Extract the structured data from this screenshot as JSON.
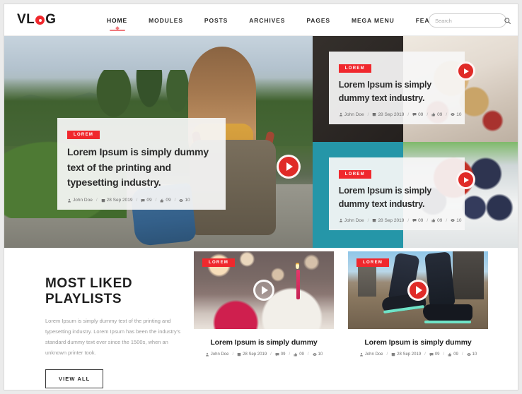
{
  "header": {
    "logo": {
      "pre": "VL",
      "post": "G",
      "icon": "record-dot-icon"
    },
    "nav": [
      {
        "label": "HOME",
        "active": true
      },
      {
        "label": "MODULES",
        "active": false
      },
      {
        "label": "POSTS",
        "active": false
      },
      {
        "label": "ARCHIVES",
        "active": false
      },
      {
        "label": "PAGES",
        "active": false
      },
      {
        "label": "MEGA MENU",
        "active": false
      },
      {
        "label": "FEATURES",
        "active": false
      }
    ],
    "search": {
      "placeholder": "Search",
      "value": "",
      "icon": "search-icon"
    }
  },
  "hero": {
    "main": {
      "badge": "LOREM",
      "title": "Lorem Ipsum is simply dummy text of the printing and typesetting industry.",
      "meta": {
        "author": "John Doe",
        "date": "28 Sep 2019",
        "comments": "09",
        "likes": "09",
        "views": "10"
      },
      "play": "play-button-icon"
    },
    "right_top": {
      "badge": "LOREM",
      "title": "Lorem Ipsum is simply dummy text industry.",
      "meta": {
        "author": "John Doe",
        "date": "28 Sep 2019",
        "comments": "09",
        "likes": "09",
        "views": "10"
      },
      "play": "play-button-icon",
      "bg_color": "#2e2826"
    },
    "right_bottom": {
      "badge": "LOREM",
      "title": "Lorem Ipsum is simply dummy text industry.",
      "meta": {
        "author": "John Doe",
        "date": "28 Sep 2019",
        "comments": "09",
        "likes": "09",
        "views": "10"
      },
      "play": "play-button-icon",
      "bg_color": "#2596a8"
    }
  },
  "playlists": {
    "heading_line1": "MOST LIKED",
    "heading_line2": "PLAYLISTS",
    "description": "Lorem Ipsum is simply dummy text of the printing and typesetting industry. Lorem Ipsum has been the industry's standard dummy text ever since the 1500s, when an unknown printer took.",
    "view_all_label": "VIEW ALL",
    "cards": [
      {
        "badge": "LOREM",
        "title": "Lorem Ipsum is simply dummy",
        "meta": {
          "author": "John Doe",
          "date": "28 Sep 2019",
          "comments": "09",
          "likes": "09",
          "views": "10"
        },
        "play_style": "ghost"
      },
      {
        "badge": "LOREM",
        "title": "Lorem Ipsum is simply dummy",
        "meta": {
          "author": "John Doe",
          "date": "28 Sep 2019",
          "comments": "09",
          "likes": "09",
          "views": "10"
        },
        "play_style": "solid"
      }
    ]
  },
  "colors": {
    "accent_red": "#f0282d",
    "teal": "#2596a8",
    "dark": "#2e2826",
    "text": "#222222",
    "muted": "#9a9a9a"
  },
  "separators": {
    "slash": "/"
  }
}
